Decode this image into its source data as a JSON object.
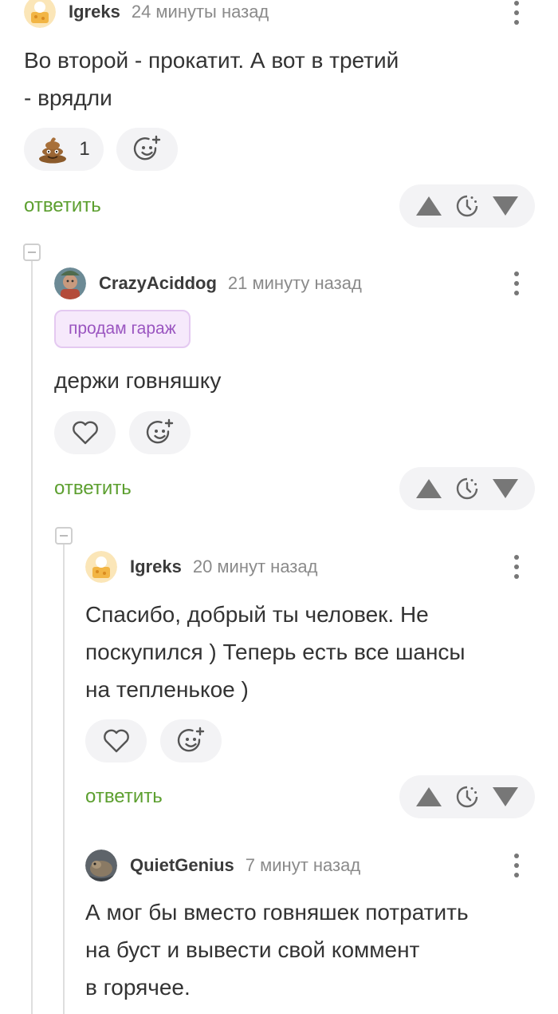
{
  "comments": [
    {
      "author": "Igreks",
      "time": "24 минуты назад",
      "text_lines": [
        "Во второй - прокатит. А вот в третий",
        "- врядли"
      ],
      "reaction_emoji": "poop",
      "reaction_count": "1",
      "reply_label": "ответить"
    },
    {
      "author": "CrazyAciddog",
      "time": "21 минуту назад",
      "badge": "продам гараж",
      "text_lines": [
        "держи говняшку"
      ],
      "reply_label": "ответить"
    },
    {
      "author": "Igreks",
      "time": "20 минут назад",
      "text_lines": [
        "Спасибо, добрый ты человек. Не",
        "поскупился ) Теперь есть все шансы",
        "на тепленькое )"
      ],
      "reply_label": "ответить"
    },
    {
      "author": "QuietGenius",
      "time": "7 минут назад",
      "text_lines": [
        "А мог бы вместо говняшек потратить",
        "на буст и вывести свой коммент",
        "в горячее."
      ]
    }
  ],
  "icons": {
    "heart": "heart-icon",
    "add_reaction": "add-reaction-icon",
    "upvote": "upvote-arrow-icon",
    "save": "save-later-icon",
    "downvote": "downvote-arrow-icon",
    "menu": "more-vertical-icon",
    "collapse": "collapse-thread-icon"
  },
  "colors": {
    "reply_green": "#5c9f2f",
    "badge_purple": "#9a55c0",
    "pill_bg": "#f3f3f5"
  }
}
